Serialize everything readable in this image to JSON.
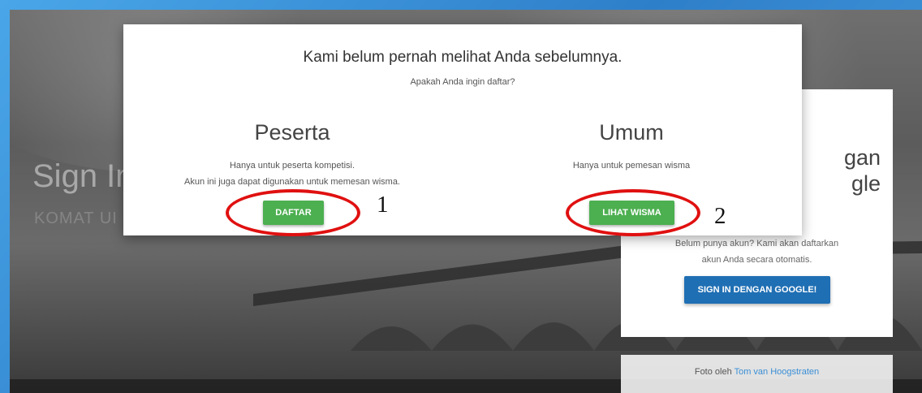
{
  "page": {
    "heading": "Sign In",
    "subheading": "KOMAT UI"
  },
  "google_card": {
    "title_line1": "gan",
    "title_line2": "gle",
    "text_line1": "Belum punya akun? Kami akan daftarkan",
    "text_line2": "akun Anda secara otomatis.",
    "button_label": "SIGN IN DENGAN GOOGLE!"
  },
  "photo_credit": {
    "prefix": "Foto oleh ",
    "author": "Tom van Hoogstraten"
  },
  "modal": {
    "title": "Kami belum pernah melihat Anda sebelumnya.",
    "subtitle": "Apakah Anda ingin daftar?",
    "peserta": {
      "title": "Peserta",
      "text_line1": "Hanya untuk peserta kompetisi.",
      "text_line2": "Akun ini juga dapat digunakan untuk memesan wisma.",
      "button_label": "DAFTAR"
    },
    "umum": {
      "title": "Umum",
      "text_line1": "Hanya untuk pemesan wisma",
      "button_label": "LIHAT WISMA"
    }
  },
  "annotations": {
    "label_1": "1",
    "label_2": "2",
    "color": "#e01010"
  },
  "colors": {
    "primary_button": "#4caf50",
    "google_button": "#1f6fb4",
    "frame_blue": "#3d92d8"
  }
}
